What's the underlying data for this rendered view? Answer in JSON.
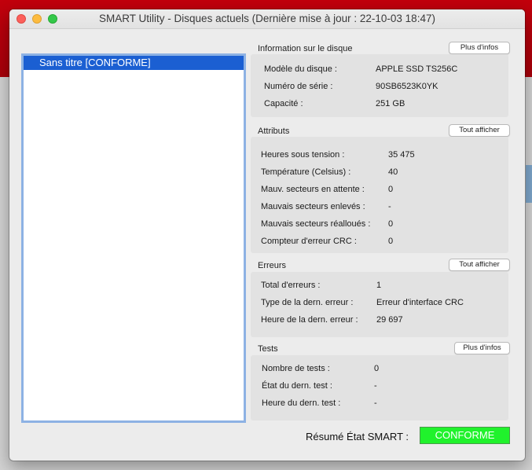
{
  "window": {
    "title": "SMART Utility - Disques actuels (Dernière mise à jour : 22-10-03 18:47)"
  },
  "disks": [
    {
      "label": "Sans titre  [CONFORME]"
    }
  ],
  "info": {
    "title": "Information sur le disque",
    "button": "Plus d'infos",
    "rows": [
      {
        "label": "Modèle du disque :",
        "value": "APPLE SSD TS256C"
      },
      {
        "label": "Numéro de série :",
        "value": "90SB6523K0YK"
      },
      {
        "label": "Capacité :",
        "value": "251 GB"
      }
    ]
  },
  "attributes": {
    "title": "Attributs",
    "button": "Tout afficher",
    "rows": [
      {
        "label": "Heures sous tension :",
        "value": "35 475"
      },
      {
        "label": "Température (Celsius) :",
        "value": "40"
      },
      {
        "label": "Mauv. secteurs en attente :",
        "value": "0"
      },
      {
        "label": "Mauvais secteurs enlevés :",
        "value": "-"
      },
      {
        "label": "Mauvais secteurs réalloués :",
        "value": "0"
      },
      {
        "label": "Compteur d'erreur CRC :",
        "value": "0"
      }
    ]
  },
  "errors": {
    "title": "Erreurs",
    "button": "Tout afficher",
    "rows": [
      {
        "label": "Total d'erreurs :",
        "value": "1"
      },
      {
        "label": "Type de la dern. erreur :",
        "value": "Erreur d'interface CRC"
      },
      {
        "label": "Heure de la dern. erreur :",
        "value": "29 697"
      }
    ]
  },
  "tests": {
    "title": "Tests",
    "button": "Plus d'infos",
    "rows": [
      {
        "label": "Nombre de tests :",
        "value": "0"
      },
      {
        "label": "État du dern. test :",
        "value": "-"
      },
      {
        "label": "Heure du dern. test :",
        "value": "-"
      }
    ]
  },
  "summary": {
    "label": "Résumé État SMART :",
    "status": "CONFORME"
  },
  "colors": {
    "status_ok": "#20f22c",
    "selection": "#1b5fd2"
  }
}
